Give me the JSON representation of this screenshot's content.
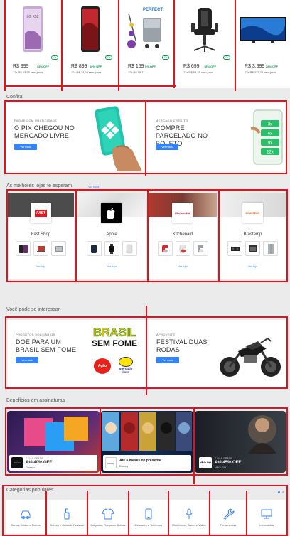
{
  "products": [
    {
      "name": "LG K52",
      "price": "R$ 999",
      "off": "38% OFF",
      "installments": "12x R$ 83,25 sem juros"
    },
    {
      "name": "Samsung Galaxy A02",
      "price": "R$ 899",
      "off": "10% OFF",
      "installments": "12x R$ 74,92 sem juros"
    },
    {
      "name": "Perfect Mop",
      "price": "R$ 159",
      "off": "5% OFF",
      "installments": "12x R$ 15,11"
    },
    {
      "name": "Cadeira Gamer",
      "price": "R$ 699",
      "off": "18% OFF",
      "installments": "12x R$ 58,25 sem juros"
    },
    {
      "name": "Smart TV",
      "price": "R$ 3.999",
      "off": "26% OFF",
      "installments": "12x R$ 333,25 sem juros"
    }
  ],
  "product_badge": "Cb",
  "confira": {
    "title": "Confira",
    "cards": [
      {
        "small": "PAGUE COM PRATICIDADE",
        "big": "O PIX CHEGOU NO MERCADO LIVRE",
        "button": "Ver mais"
      },
      {
        "small": "MERCADO CRÉDITO",
        "big": "COMPRE PARCELADO NO BOLETO",
        "button": "Ver mais",
        "options": [
          "3x",
          "6x",
          "9x",
          "12x"
        ]
      }
    ]
  },
  "stores": {
    "title": "As melhores lojas te esperam",
    "link": "Ver lojas",
    "items": [
      {
        "name": "Fast Shop",
        "logo": "FAST",
        "link": "Ver loja"
      },
      {
        "name": "Apple",
        "logo": "",
        "link": "Ver loja"
      },
      {
        "name": "Kitchenaid",
        "logo": "KitchenAid",
        "link": "Ver loja"
      },
      {
        "name": "Brastemp",
        "logo": "BRASTEMP",
        "link": "Ver loja"
      }
    ]
  },
  "interest": {
    "title": "Você pode se interessar",
    "cards": [
      {
        "small": "PRODUTOS SOLIDÁRIOS",
        "big": "DOE PARA UM BRASIL SEM FOME",
        "button": "Ver mais",
        "logo_top": "BRASIL",
        "logo_bottom": "SEM FOME",
        "partner1": "Ação",
        "partner2": "mercado livre"
      },
      {
        "small": "APROVEITE",
        "big": "FESTIVAL DUAS RODAS",
        "button": "Ver mais"
      }
    ]
  },
  "subscriptions": {
    "title": "Benefícios em assinaturas",
    "items": [
      {
        "tag": "7 DIAS GRÁTIS",
        "offer": "Até 40% OFF",
        "service": "Deezer",
        "logo": "deezer"
      },
      {
        "tag": "",
        "offer": "Até 6 meses de presente",
        "service": "Disney+",
        "logo": "Disney"
      },
      {
        "tag": "7 DIAS GRÁTIS",
        "offer": "Até 45% OFF",
        "service": "HBO GO",
        "logo": "HBO GO"
      }
    ]
  },
  "categories": {
    "title": "Categorias populares",
    "items": [
      {
        "label": "Carros, Motos e Outros"
      },
      {
        "label": "Beleza e Cuidado Pessoal"
      },
      {
        "label": "Calçados, Roupas e Bolsas"
      },
      {
        "label": "Celulares e Telefones"
      },
      {
        "label": "Eletrônicos, Áudio e Vídeo"
      },
      {
        "label": "Ferramentas"
      },
      {
        "label": "Informática"
      }
    ]
  },
  "colors": {
    "accent": "#3483fa",
    "annotation": "#e8101c",
    "green": "#00a650"
  }
}
